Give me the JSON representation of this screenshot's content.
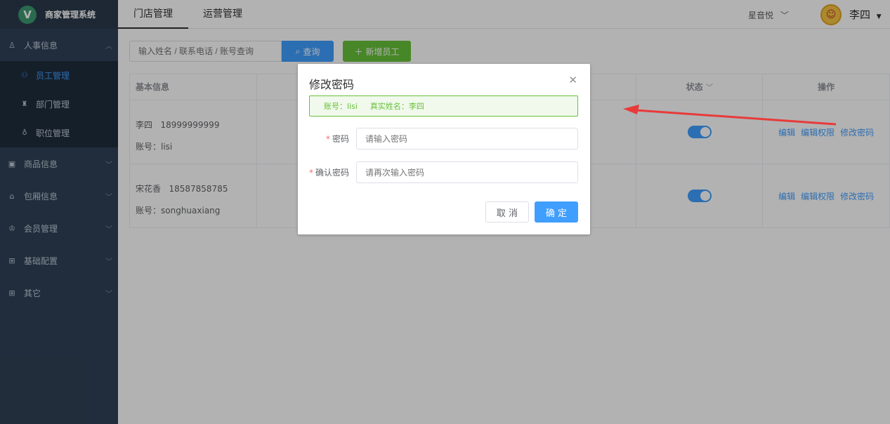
{
  "brand": {
    "logo_letter": "V",
    "name": "商家管理系统"
  },
  "sidebar": {
    "groups": [
      {
        "label": "人事信息",
        "icon": "user-icon",
        "expanded": true,
        "items": [
          {
            "label": "员工管理",
            "icon": "users-icon",
            "active": true
          },
          {
            "label": "部门管理",
            "icon": "org-icon",
            "active": false
          },
          {
            "label": "职位管理",
            "icon": "position-icon",
            "active": false
          }
        ]
      },
      {
        "label": "商品信息",
        "icon": "calendar-icon"
      },
      {
        "label": "包厢信息",
        "icon": "home-icon"
      },
      {
        "label": "会员管理",
        "icon": "crown-icon"
      },
      {
        "label": "基础配置",
        "icon": "grid-icon"
      },
      {
        "label": "其它",
        "icon": "grid-icon"
      }
    ]
  },
  "header": {
    "tabs": [
      {
        "label": "门店管理",
        "active": true
      },
      {
        "label": "运营管理",
        "active": false
      }
    ],
    "store": "星音悦",
    "user": "李四"
  },
  "toolbar": {
    "search_placeholder": "输入姓名 / 联系电话 / 账号查询",
    "query_label": "查询",
    "add_label": "新增员工"
  },
  "table": {
    "headers": {
      "info": "基本信息",
      "status": "状态",
      "ops": "操作"
    },
    "rows": [
      {
        "name": "李四",
        "phone": "18999999999",
        "account": "账号：lisi",
        "enabled": true
      },
      {
        "name": "宋花香",
        "phone": "18587858785",
        "account": "账号：songhuaxiang",
        "enabled": true
      }
    ],
    "ops": [
      "编辑",
      "编辑权限",
      "修改密码"
    ]
  },
  "dialog": {
    "title": "修改密码",
    "alert_account": "账号：lisi",
    "alert_realname": "真实姓名：李四",
    "password_label": "密码",
    "password_placeholder": "请输入密码",
    "confirm_label": "确认密码",
    "confirm_placeholder": "请再次输入密码",
    "cancel_label": "取 消",
    "ok_label": "确 定"
  },
  "colors": {
    "primary": "#409eff",
    "success": "#67c23a",
    "sidebar": "#304156",
    "annotation": "#e83a3a"
  }
}
